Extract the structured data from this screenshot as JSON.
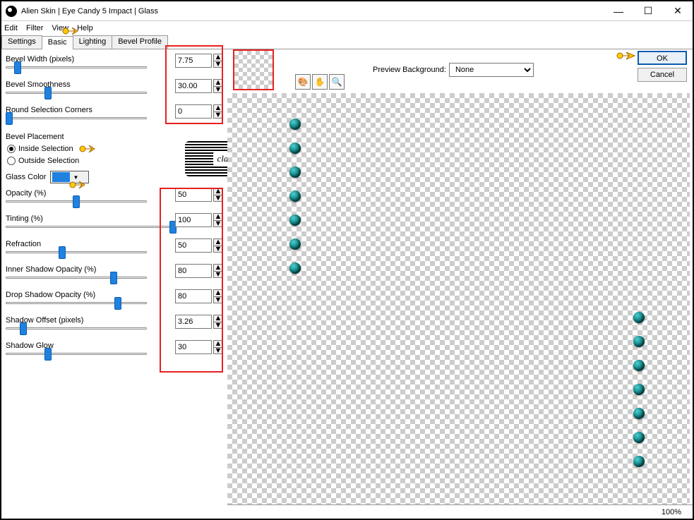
{
  "window": {
    "title": "Alien Skin | Eye Candy 5 Impact | Glass"
  },
  "menu": {
    "edit": "Edit",
    "filter": "Filter",
    "view": "View",
    "help": "Help"
  },
  "tabs": {
    "settings": "Settings",
    "basic": "Basic",
    "lighting": "Lighting",
    "bevel": "Bevel Profile"
  },
  "params": {
    "bevelWidth": {
      "label": "Bevel Width (pixels)",
      "value": "7.75",
      "thumb": 8
    },
    "bevelSmooth": {
      "label": "Bevel Smoothness",
      "value": "30.00",
      "thumb": 30
    },
    "roundCorners": {
      "label": "Round Selection Corners",
      "value": "0",
      "thumb": 2
    },
    "opacity": {
      "label": "Opacity (%)",
      "value": "50",
      "thumb": 50
    },
    "tinting": {
      "label": "Tinting (%)",
      "value": "100",
      "thumb": 100
    },
    "refraction": {
      "label": "Refraction",
      "value": "50",
      "thumb": 40
    },
    "innerShadow": {
      "label": "Inner Shadow Opacity (%)",
      "value": "80",
      "thumb": 77
    },
    "dropShadow": {
      "label": "Drop Shadow Opacity (%)",
      "value": "80",
      "thumb": 80
    },
    "shadowOffset": {
      "label": "Shadow Offset (pixels)",
      "value": "3.26",
      "thumb": 12
    },
    "shadowGlow": {
      "label": "Shadow Glow",
      "value": "30",
      "thumb": 30
    }
  },
  "bevelPlacement": {
    "label": "Bevel Placement",
    "inside": "Inside Selection",
    "outside": "Outside Selection"
  },
  "glassColor": {
    "label": "Glass Color",
    "hex": "#2082e0"
  },
  "preview": {
    "bgLabel": "Preview Background:",
    "bgValue": "None"
  },
  "buttons": {
    "ok": "OK",
    "cancel": "Cancel"
  },
  "status": {
    "zoom": "100%"
  },
  "watermark": "claudia"
}
